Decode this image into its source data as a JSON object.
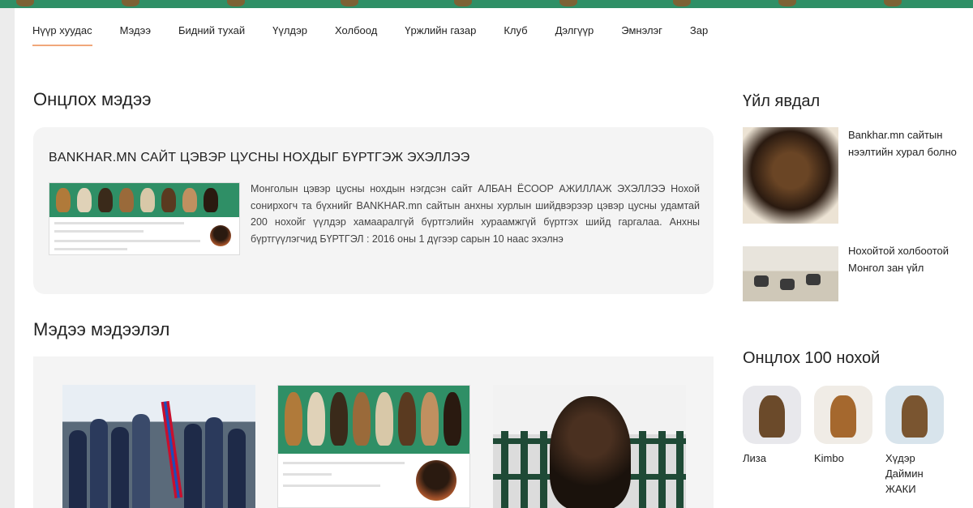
{
  "nav": {
    "items": [
      {
        "label": "Нүүр хуудас",
        "active": true
      },
      {
        "label": "Мэдээ",
        "active": false
      },
      {
        "label": "Бидний тухай",
        "active": false
      },
      {
        "label": "Үүлдэр",
        "active": false
      },
      {
        "label": "Холбоод",
        "active": false
      },
      {
        "label": "Үржлийн газар",
        "active": false
      },
      {
        "label": "Клуб",
        "active": false
      },
      {
        "label": "Дэлгүүр",
        "active": false
      },
      {
        "label": "Эмнэлэг",
        "active": false
      },
      {
        "label": "Зар",
        "active": false
      }
    ]
  },
  "featured": {
    "section_title": "Онцлох мэдээ",
    "headline": "BANKHAR.MN САЙТ ЦЭВЭР ЦУСНЫ НОХДЫГ БҮРТГЭЖ ЭХЭЛЛЭЭ",
    "excerpt": "Монголын цэвэр цусны нохдын нэгдсэн сайт АЛБАН ЁСООР АЖИЛЛАЖ ЭХЭЛЛЭЭ Нохой сонирхогч та бүхнийг BANKHAR.mn сайтын анхны хурлын шийдвэрээр цэвэр цусны удамтай 200 нохойг үүлдэр хамааралгүй бүртгэлийн хураамжгүй бүртгэх шийд гаргалаа. Анхны бүртгүүлэгчид БҮРТГЭЛ : 2016 оны 1 дүгээр сарын 10 нааc эхэлнэ"
  },
  "news": {
    "section_title": "Мэдээ мэдээлэл"
  },
  "events": {
    "section_title": "Үйл явдал",
    "items": [
      {
        "title": "Bankhar.mn сайтын нээлтийн хурал болно"
      },
      {
        "title": "Нохойтой холбоотой Монгол зан үйл"
      }
    ]
  },
  "top_dogs": {
    "section_title": "Онцлох 100 нохой",
    "items": [
      {
        "name": "Лиза"
      },
      {
        "name": "Kimbo"
      },
      {
        "name": "Хүдэр Даймин ЖАКИ"
      }
    ]
  },
  "colors": {
    "brand_green": "#2f8f66",
    "active_underline": "#f0a77a",
    "card_bg": "#f4f4f4"
  }
}
